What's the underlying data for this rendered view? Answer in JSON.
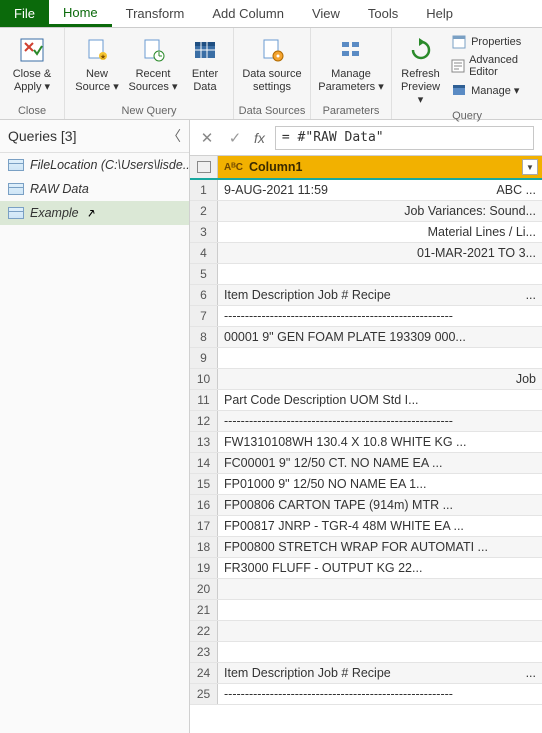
{
  "tabs": {
    "file": "File",
    "home": "Home",
    "transform": "Transform",
    "addColumn": "Add Column",
    "view": "View",
    "tools": "Tools",
    "help": "Help"
  },
  "ribbon": {
    "closeApply": "Close &\nApply ▾",
    "closeGroup": "Close",
    "newSource": "New\nSource ▾",
    "recentSources": "Recent\nSources ▾",
    "enterData": "Enter\nData",
    "newQueryGroup": "New Query",
    "dataSourceSettings": "Data source\nsettings",
    "dataSourcesGroup": "Data Sources",
    "manageParameters": "Manage\nParameters ▾",
    "parametersGroup": "Parameters",
    "refreshPreview": "Refresh\nPreview ▾",
    "properties": "Properties",
    "advancedEditor": "Advanced Editor",
    "manage": "Manage ▾",
    "queryGroup": "Query"
  },
  "queriesPane": {
    "title": "Queries [3]",
    "items": [
      {
        "label": "FileLocation (C:\\Users\\lisde...",
        "italic": true,
        "active": false
      },
      {
        "label": "RAW Data",
        "italic": true,
        "active": false
      },
      {
        "label": "Example",
        "italic": true,
        "active": true
      }
    ]
  },
  "formula": "= #\"RAW Data\"",
  "column": {
    "typeIcon": "AᴮC",
    "name": "Column1"
  },
  "rows": [
    {
      "n": 1,
      "text": "9-AUG-2021 11:59",
      "align": "left",
      "suffix": "ABC ..."
    },
    {
      "n": 2,
      "text": "Job Variances: Sound...",
      "align": "right"
    },
    {
      "n": 3,
      "text": "Material Lines / Li...",
      "align": "right"
    },
    {
      "n": 4,
      "text": "01-MAR-2021 TO 3...",
      "align": "right"
    },
    {
      "n": 5,
      "text": "",
      "align": "left"
    },
    {
      "n": 6,
      "text": "Item       Description              Job #   Recipe",
      "align": "left",
      "suffix": "..."
    },
    {
      "n": 7,
      "text": "-------------------------------------------------------",
      "align": "left"
    },
    {
      "n": 8,
      "text": "00001     9\" GEN FOAM PLATE       193309 000...",
      "align": "left"
    },
    {
      "n": 9,
      "text": "",
      "align": "left"
    },
    {
      "n": 10,
      "text": "Job",
      "align": "right"
    },
    {
      "n": 11,
      "text": "Part Code   Description            UOM    Std I...",
      "align": "left"
    },
    {
      "n": 12,
      "text": "-------------------------------------------------------",
      "align": "left"
    },
    {
      "n": 13,
      "text": "FW1310108WH  130.4 X 10.8        WHITE KG ...",
      "align": "left"
    },
    {
      "n": 14,
      "text": "FC00001     9\" 12/50 CT. NO NAME    EA    ...",
      "align": "left"
    },
    {
      "n": 15,
      "text": "FP01000     9\" 12/50 NO NAME        EA    1...",
      "align": "left"
    },
    {
      "n": 16,
      "text": "FP00806     CARTON TAPE (914m)     MTR  ...",
      "align": "left"
    },
    {
      "n": 17,
      "text": "FP00817     JNRP - TGR-4 48M WHITE  EA  ...",
      "align": "left"
    },
    {
      "n": 18,
      "text": "FP00800     STRETCH WRAP FOR AUTOMATI ...",
      "align": "left"
    },
    {
      "n": 19,
      "text": "FR3000      FLUFF - OUTPUT          KG    22...",
      "align": "left"
    },
    {
      "n": 20,
      "text": "",
      "align": "left"
    },
    {
      "n": 21,
      "text": "",
      "align": "left"
    },
    {
      "n": 22,
      "text": "",
      "align": "left"
    },
    {
      "n": 23,
      "text": "",
      "align": "left"
    },
    {
      "n": 24,
      "text": "Item       Description              Job #   Recipe",
      "align": "left",
      "suffix": "..."
    },
    {
      "n": 25,
      "text": "-------------------------------------------------------",
      "align": "left"
    }
  ]
}
